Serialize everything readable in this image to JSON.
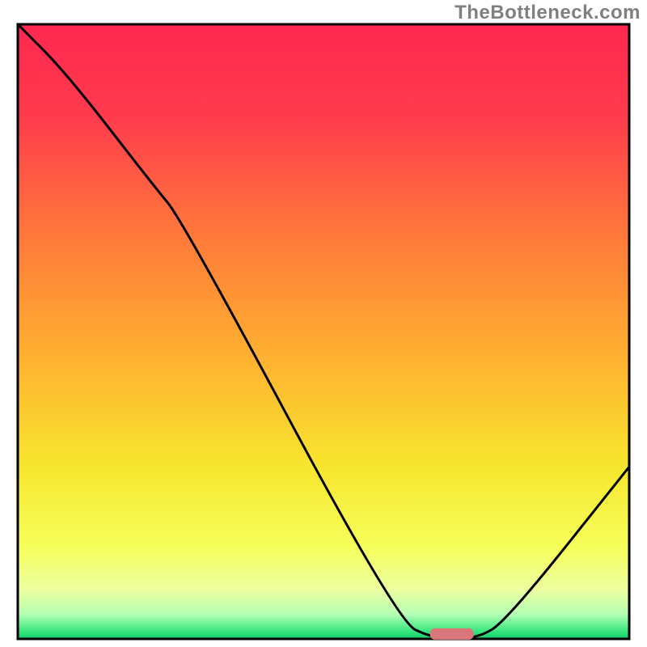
{
  "watermark": "TheBottleneck.com",
  "chart_data": {
    "type": "line",
    "title": "",
    "xlabel": "",
    "ylabel": "",
    "xlim": [
      0,
      100
    ],
    "ylim": [
      0,
      100
    ],
    "grid": false,
    "background": "vertical red→orange→yellow→green gradient ending in thin green band at bottom",
    "series": [
      {
        "name": "curve",
        "x": [
          0,
          8,
          22,
          27,
          62,
          68,
          75,
          80,
          100
        ],
        "y": [
          100,
          92,
          74,
          68,
          3,
          0,
          0,
          3,
          28
        ]
      }
    ],
    "marker": {
      "x": 71,
      "y": 0.8,
      "color": "#d9777b",
      "shape": "rounded-rect"
    },
    "gradient_stops": [
      {
        "offset": 0,
        "color": "#ff2850"
      },
      {
        "offset": 15,
        "color": "#ff3b4d"
      },
      {
        "offset": 35,
        "color": "#ff7b3a"
      },
      {
        "offset": 55,
        "color": "#ffb330"
      },
      {
        "offset": 72,
        "color": "#f7e62e"
      },
      {
        "offset": 85,
        "color": "#f6ff5a"
      },
      {
        "offset": 92,
        "color": "#ecffa0"
      },
      {
        "offset": 96,
        "color": "#b4ffb4"
      },
      {
        "offset": 99,
        "color": "#2de37a"
      },
      {
        "offset": 100,
        "color": "#18c96a"
      }
    ]
  }
}
